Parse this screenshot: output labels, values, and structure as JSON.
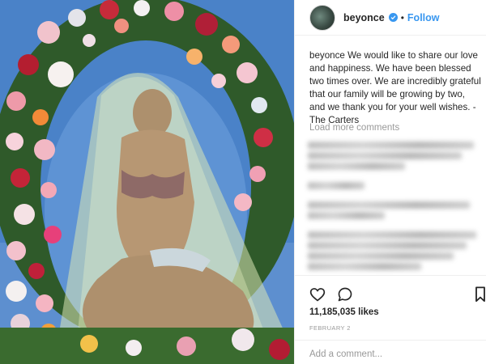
{
  "post": {
    "username": "beyonce",
    "verified": true,
    "separator": "•",
    "follow_label": "Follow",
    "caption_user": "beyonce",
    "caption_text": "We would like to share our love and happiness. We have been blessed two times over. We are incredibly grateful that our family will be growing by two, and we thank you for your well wishes. - The Carters",
    "load_more": "Load more comments",
    "likes": "11,185,035 likes",
    "date": "FEBRUARY 2",
    "comment_placeholder": "Add a comment..."
  },
  "colors": {
    "link_blue": "#3897f0",
    "text": "#262626",
    "muted": "#999999",
    "sky": "#4a82c8"
  },
  "icons": {
    "verified": "verified-badge-icon",
    "like": "heart-icon",
    "comment": "comment-bubble-icon",
    "save": "bookmark-icon"
  }
}
